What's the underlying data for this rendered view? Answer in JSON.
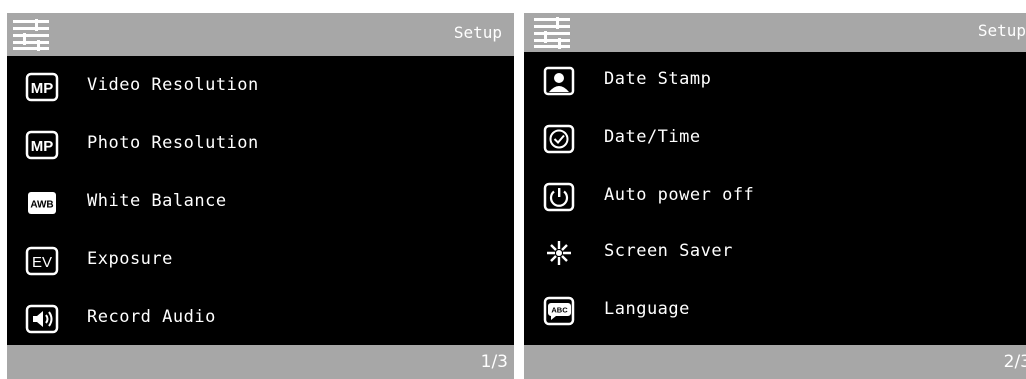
{
  "colors": {
    "background": "#000000",
    "bar": "#a7a7a7",
    "text": "#ffffff"
  },
  "screens": [
    {
      "header": {
        "icon": "settings-sliders-icon",
        "title": "Setup"
      },
      "items": [
        {
          "icon": "mp-icon",
          "icon_text": "MP",
          "label": "Video Resolution"
        },
        {
          "icon": "mp-icon",
          "icon_text": "MP",
          "label": "Photo Resolution"
        },
        {
          "icon": "awb-icon",
          "icon_text": "AWB",
          "label": "White Balance"
        },
        {
          "icon": "ev-icon",
          "icon_text": "EV",
          "label": "Exposure"
        },
        {
          "icon": "speaker-icon",
          "label": "Record Audio"
        }
      ],
      "footer": {
        "page": "1/3"
      }
    },
    {
      "header": {
        "icon": "settings-sliders-icon",
        "title": "Setup"
      },
      "items": [
        {
          "icon": "portrait-icon",
          "label": "Date Stamp"
        },
        {
          "icon": "clock-icon",
          "label": "Date/Time"
        },
        {
          "icon": "power-icon",
          "label": "Auto power off"
        },
        {
          "icon": "brightness-icon",
          "label": "Screen Saver"
        },
        {
          "icon": "abc-bubble-icon",
          "icon_text": "ABC",
          "label": "Language"
        }
      ],
      "footer": {
        "page": "2/3"
      }
    }
  ]
}
